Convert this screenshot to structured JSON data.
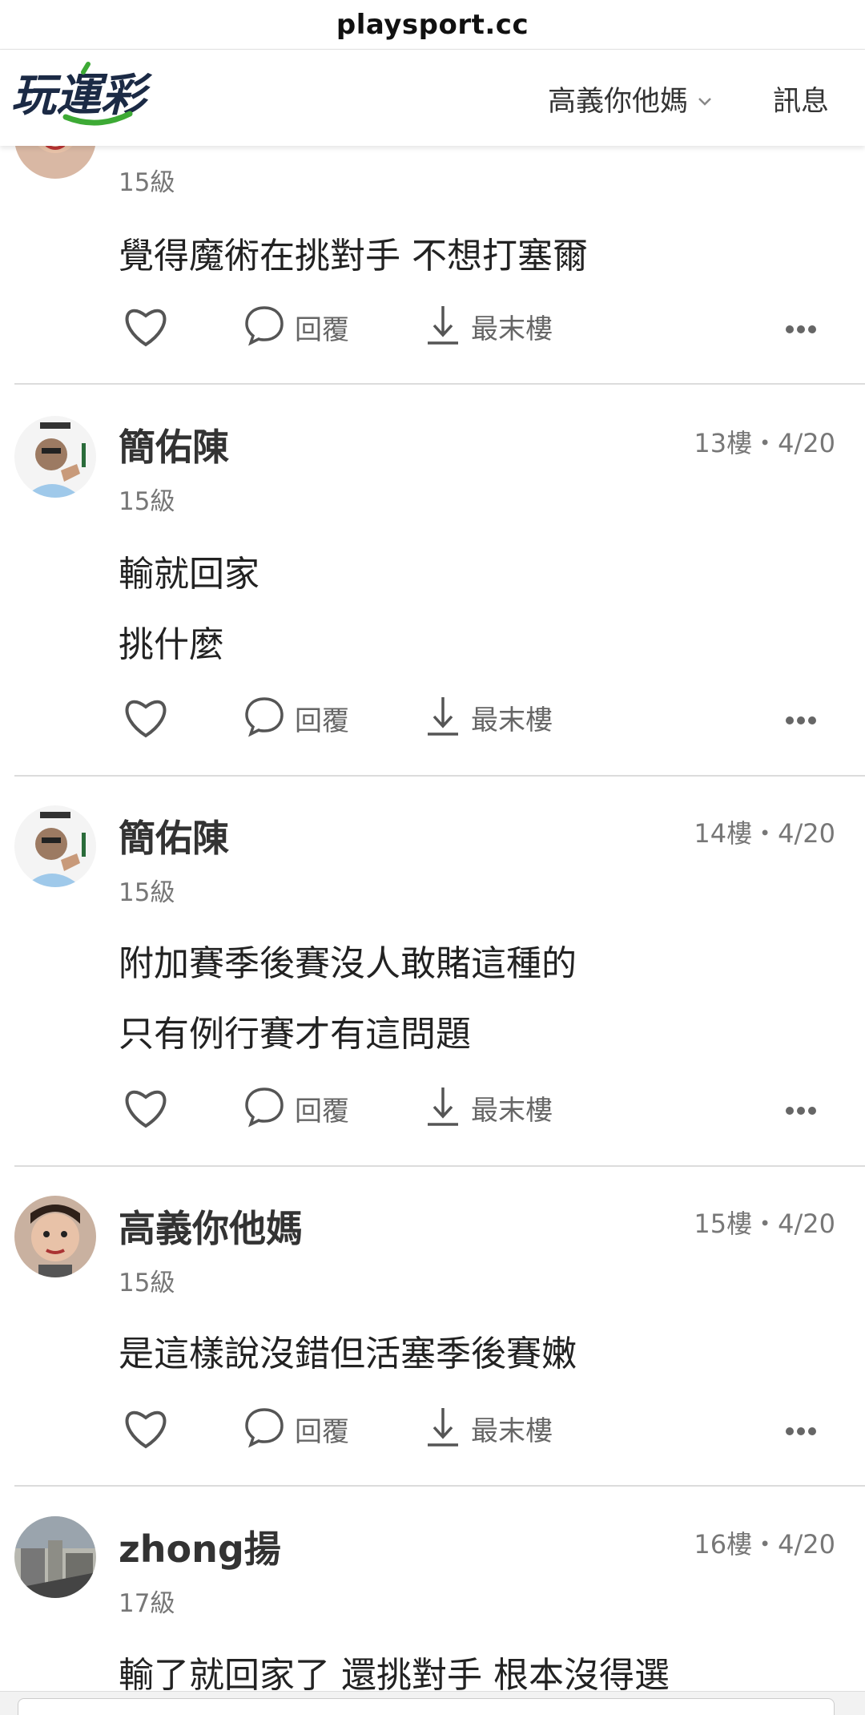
{
  "browser": {
    "url": "playsport.cc"
  },
  "header": {
    "logo_text": "玩運彩",
    "user_menu": "高義你他媽",
    "messages": "訊息"
  },
  "colors": {
    "brand_green": "#3daa35",
    "logo_dark": "#1b2a45",
    "divider": "#dcdcdc"
  },
  "actions": {
    "reply": "回覆",
    "last_floor": "最末樓"
  },
  "posts": [
    {
      "name": "",
      "level": "15級",
      "floor": "",
      "lines": [
        "覺得魔術在挑對手 不想打塞爾"
      ]
    },
    {
      "name": "簡佑陳",
      "level": "15級",
      "floor": "13樓・4/20",
      "lines": [
        "輸就回家",
        "挑什麼"
      ]
    },
    {
      "name": "簡佑陳",
      "level": "15級",
      "floor": "14樓・4/20",
      "lines": [
        "附加賽季後賽沒人敢賭這種的",
        "只有例行賽才有這問題"
      ]
    },
    {
      "name": "高義你他媽",
      "level": "15級",
      "floor": "15樓・4/20",
      "lines": [
        "是這樣說沒錯但活塞季後賽嫩"
      ]
    },
    {
      "name": "zhong揚",
      "level": "17級",
      "floor": "16樓・4/20",
      "lines": [
        "輸了就回家了 還挑對手 根本沒得選"
      ]
    }
  ]
}
